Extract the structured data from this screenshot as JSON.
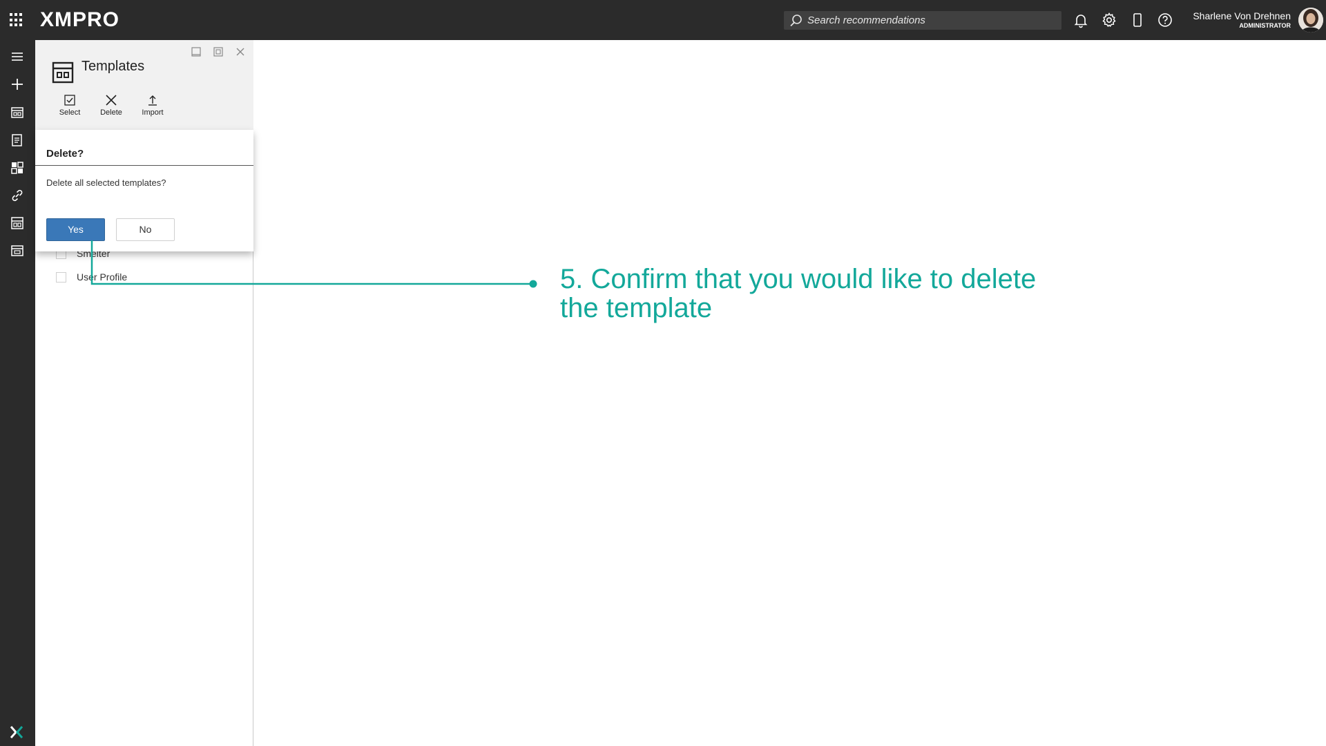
{
  "app": {
    "brand": "XMPRO"
  },
  "topbar": {
    "search_placeholder": "Search recommendations",
    "icons": [
      "apps-icon",
      "bell-icon",
      "gear-icon",
      "mobile-icon",
      "help-icon"
    ],
    "user": {
      "name": "Sharlene Von Drehnen",
      "role": "ADMINISTRATOR"
    }
  },
  "leftnav": {
    "icons": [
      "menu-icon",
      "add-icon",
      "app-designer-icon",
      "recommendations-icon",
      "data-streams-icon",
      "integrations-icon",
      "templates-icon",
      "pages-icon",
      "xmpro-logo-icon"
    ]
  },
  "panel": {
    "title": "Templates",
    "toolbar": {
      "select_label": "Select",
      "delete_label": "Delete",
      "import_label": "Import"
    },
    "items": [
      {
        "label": "Smelter"
      },
      {
        "label": "User Profile"
      }
    ]
  },
  "dialog": {
    "title": "Delete?",
    "message": "Delete all selected templates?",
    "yes_label": "Yes",
    "no_label": "No"
  },
  "callout": {
    "text": "5. Confirm that you would like to delete the template",
    "color": "#13a89a"
  },
  "colors": {
    "topbar_bg": "#2b2b2b",
    "primary_button": "#3a78b8",
    "accent": "#13a89a"
  }
}
